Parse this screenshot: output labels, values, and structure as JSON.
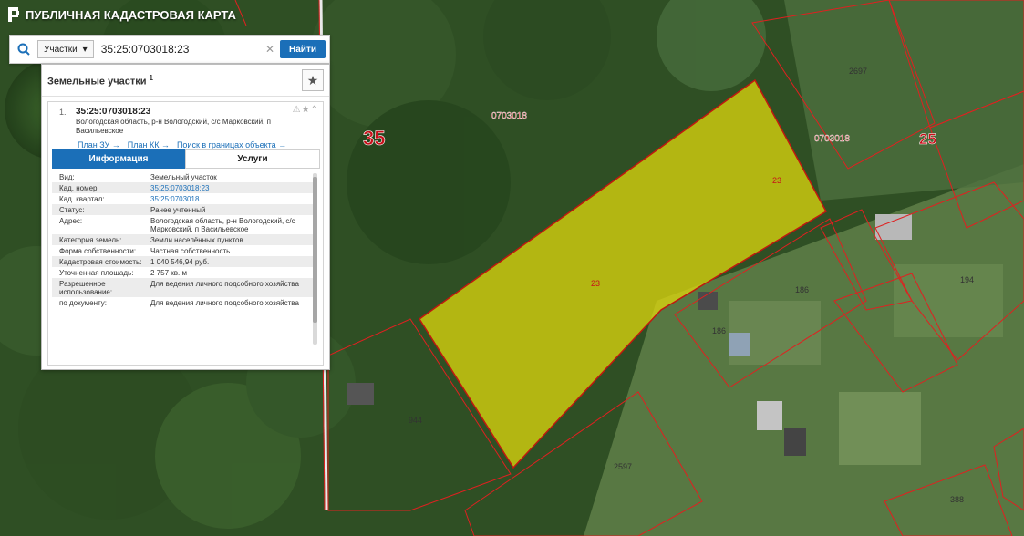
{
  "app": {
    "title": "ПУБЛИЧНАЯ КАДАСТРОВАЯ КАРТА"
  },
  "search": {
    "type": "Участки",
    "query": "35:25:0703018:23",
    "find": "Найти"
  },
  "panel": {
    "title": "Земельные участки",
    "count": "1"
  },
  "result": {
    "index": "1.",
    "cad": "35:25:0703018:23",
    "addr": "Вологодская область, р-н Вологодский, с/с Марковский, п Васильевское",
    "links": [
      "План ЗУ →",
      "План КК →",
      "Поиск в границах объекта →"
    ],
    "tabs": [
      "Информация",
      "Услуги"
    ]
  },
  "info": [
    {
      "label": "Вид:",
      "value": "Земельный участок"
    },
    {
      "label": "Кад. номер:",
      "value": "35:25:0703018:23"
    },
    {
      "label": "Кад. квартал:",
      "value": "35:25:0703018"
    },
    {
      "label": "Статус:",
      "value": "Ранее учтенный"
    },
    {
      "label": "Адрес:",
      "value": "Вологодская область, р-н Вологодский, с/с Марковский, п Васильевское"
    },
    {
      "label": "Категория земель:",
      "value": "Земли населённых пунктов"
    },
    {
      "label": "Форма собственности:",
      "value": "Частная собственность"
    },
    {
      "label": "Кадастровая стоимость:",
      "value": "1 040 546,94 руб."
    },
    {
      "label": "Уточненная площадь:",
      "value": "2 757 кв. м"
    },
    {
      "label": "Разрешенное использование:",
      "value": "Для ведения личного подсобного хозяйства"
    },
    {
      "label": "по документу:",
      "value": "Для ведения личного подсобного хозяйства"
    }
  ],
  "map": {
    "district_left": "35",
    "district_right": "25",
    "quarter_a": "0703018",
    "quarter_b": "0703018",
    "parcel_labels": [
      "23",
      "23",
      "186",
      "186",
      "194",
      "2697",
      "944",
      "2597",
      "388"
    ]
  },
  "colors": {
    "accent": "#1b6fb8",
    "parcel_fill": "#e0d80c",
    "boundary": "#e02020"
  }
}
